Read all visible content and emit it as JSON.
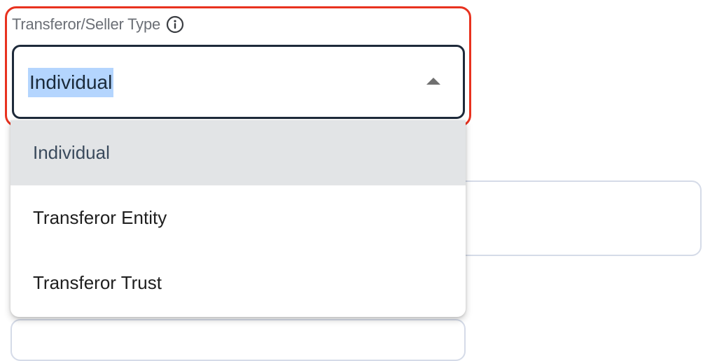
{
  "field": {
    "label": "Transferor/Seller Type",
    "info_icon": "info-circle-icon",
    "selected_value": "Individual",
    "caret_icon": "caret-up-icon"
  },
  "dropdown": {
    "options": [
      {
        "label": "Individual",
        "selected": true
      },
      {
        "label": "Transferor Entity",
        "selected": false
      },
      {
        "label": "Transferor Trust",
        "selected": false
      }
    ]
  },
  "colors": {
    "highlight_border": "#e8321f",
    "select_border": "#1e2a3a",
    "selection_highlight": "#b4d5fe",
    "selected_option_bg": "#e2e4e6"
  }
}
